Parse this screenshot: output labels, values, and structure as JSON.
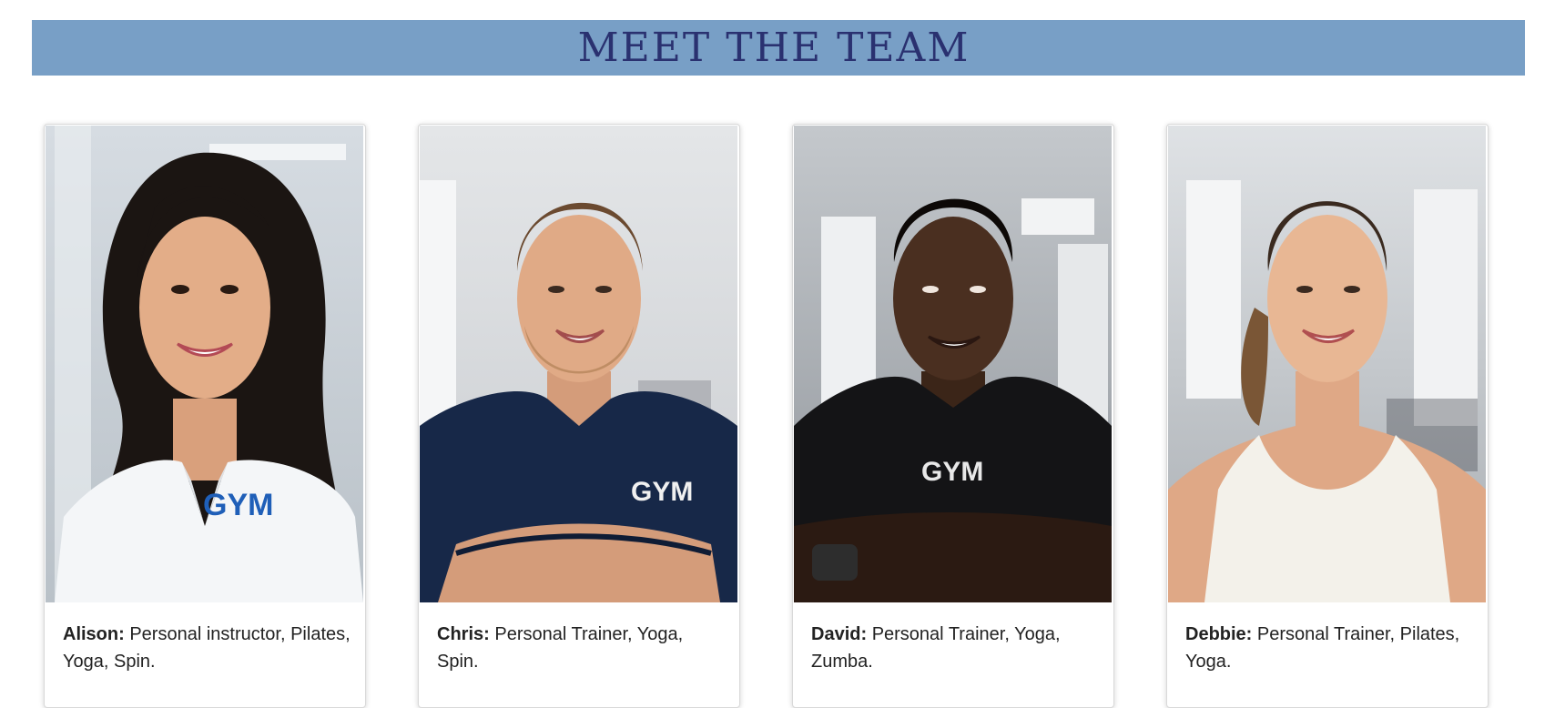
{
  "banner": {
    "title": "MEET THE TEAM"
  },
  "team": [
    {
      "name": "Alison:",
      "roles": "Personal instructor, Pilates, Yoga, Spin.",
      "shirt_text": "GYM"
    },
    {
      "name": "Chris:",
      "roles": "Personal Trainer, Yoga, Spin.",
      "shirt_text": "GYM"
    },
    {
      "name": "David:",
      "roles": "Personal Trainer, Yoga, Zumba.",
      "shirt_text": "GYM"
    },
    {
      "name": "Debbie:",
      "roles": "Personal Trainer, Pilates, Yoga.",
      "shirt_text": ""
    }
  ],
  "colors": {
    "banner_bg": "#789fc6",
    "banner_text": "#2a3170"
  }
}
